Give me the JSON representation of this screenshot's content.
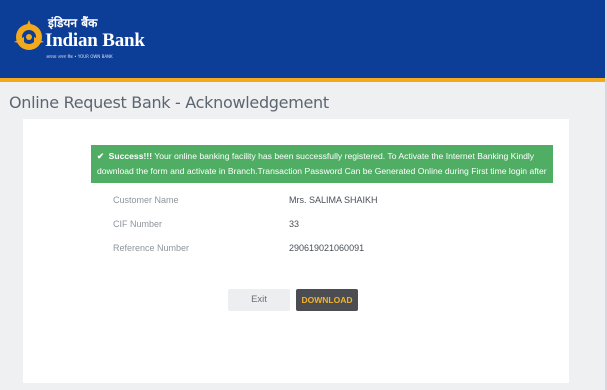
{
  "header": {
    "bank_name_hindi": "इंडियन बैंक",
    "bank_name_english": "Indian Bank",
    "tagline": "आपका अपना बैंक  •  YOUR OWN BANK",
    "colors": {
      "background": "#0c3d97",
      "stripe": "#f3a91c",
      "logo": "#f3a91c"
    },
    "logo_icon": "indian-bank-logo"
  },
  "page": {
    "title": "Online Request Bank - Acknowledgement"
  },
  "alert": {
    "icon": "check-icon",
    "check_glyph": "✔",
    "title": "Success!!!",
    "message": "Your online banking facility has been successfully registered. To Activate the Internet Banking Kindly download the form and activate in Branch.Transaction Password Can be Generated Online during First time login after Activation.",
    "color": "#4fae63"
  },
  "details": [
    {
      "label": "Customer Name",
      "value": "Mrs. SALIMA SHAIKH"
    },
    {
      "label": "CIF Number",
      "value": "33"
    },
    {
      "label": "Reference Number",
      "value": "290619021060091"
    }
  ],
  "actions": {
    "exit_label": "Exit",
    "download_label": "DOWNLOAD"
  }
}
